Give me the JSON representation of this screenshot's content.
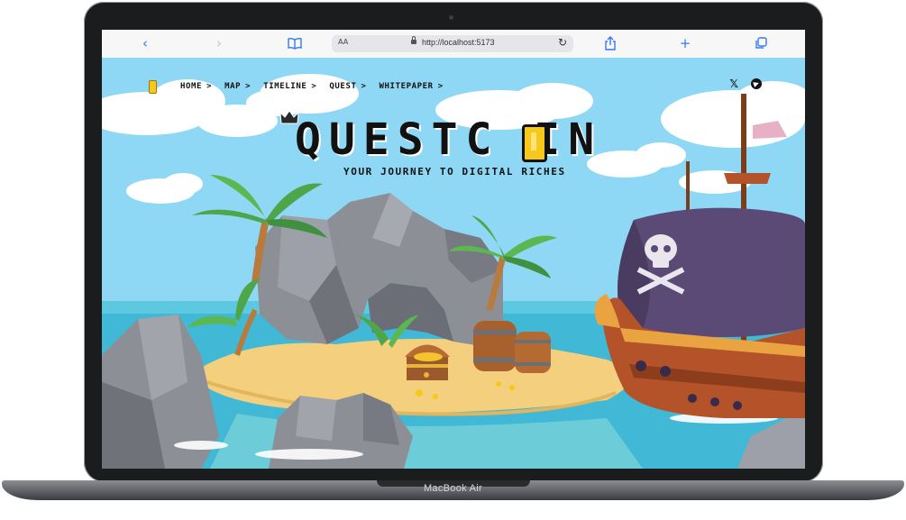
{
  "device": {
    "brand_label": "MacBook Air"
  },
  "browser": {
    "back_icon": "‹",
    "forward_icon": "›",
    "reader_icon": "book-icon",
    "text_size_label": "AA",
    "url": "http://localhost:5173",
    "reload_icon": "↻",
    "share_icon": "share-icon",
    "new_tab_icon": "+",
    "tabs_icon": "tabs-icon"
  },
  "site": {
    "nav": [
      {
        "label": "HOME"
      },
      {
        "label": "MAP"
      },
      {
        "label": "TIMELINE"
      },
      {
        "label": "QUEST"
      },
      {
        "label": "WHITEPAPER"
      }
    ],
    "nav_chevron": ">",
    "social": {
      "x_label": "𝕏"
    },
    "logo_text": "QUESTC  IN",
    "tagline": "YOUR JOURNEY TO DIGITAL RICHES"
  },
  "colors": {
    "sky": "#8fd8f5",
    "sea": "#41b8d6",
    "sand": "#f3cf7e",
    "coin": "#f6c81a",
    "sail": "#5c4a76",
    "hull": "#b4532a",
    "accent_browser": "#3478f6"
  }
}
